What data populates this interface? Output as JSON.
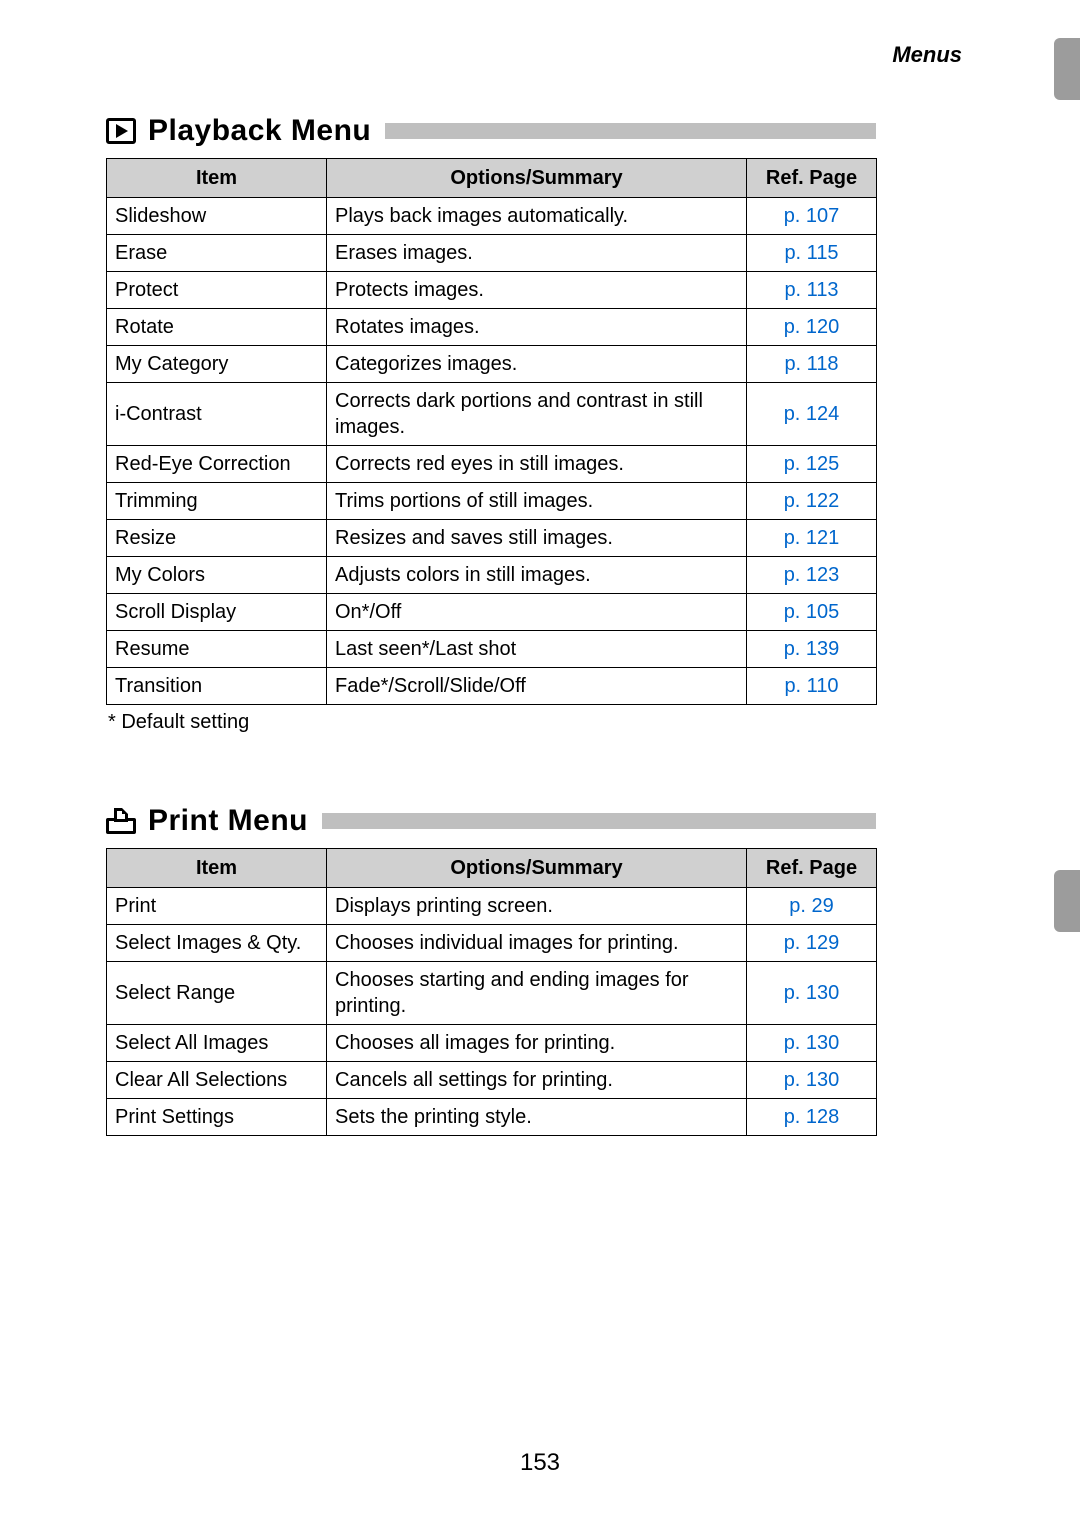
{
  "header": {
    "menus_label": "Menus"
  },
  "page_number": "153",
  "playback": {
    "title": "Playback Menu",
    "columns": {
      "item": "Item",
      "options": "Options/Summary",
      "ref": "Ref. Page"
    },
    "rows": [
      {
        "item": "Slideshow",
        "summary": "Plays back images automatically.",
        "ref": "p. 107"
      },
      {
        "item": "Erase",
        "summary": "Erases images.",
        "ref": "p. 115"
      },
      {
        "item": "Protect",
        "summary": "Protects images.",
        "ref": "p. 113"
      },
      {
        "item": "Rotate",
        "summary": "Rotates images.",
        "ref": "p. 120"
      },
      {
        "item": "My Category",
        "summary": "Categorizes images.",
        "ref": "p. 118"
      },
      {
        "item": "i-Contrast",
        "summary": "Corrects dark portions and contrast in still images.",
        "ref": "p. 124"
      },
      {
        "item": "Red-Eye Correction",
        "summary": "Corrects red eyes in still images.",
        "ref": "p. 125"
      },
      {
        "item": "Trimming",
        "summary": "Trims portions of still images.",
        "ref": "p. 122"
      },
      {
        "item": "Resize",
        "summary": "Resizes and saves still images.",
        "ref": "p. 121"
      },
      {
        "item": "My Colors",
        "summary": "Adjusts colors in still images.",
        "ref": "p. 123"
      },
      {
        "item": "Scroll Display",
        "summary": "On*/Off",
        "ref": "p. 105"
      },
      {
        "item": "Resume",
        "summary": "Last seen*/Last shot",
        "ref": "p. 139"
      },
      {
        "item": "Transition",
        "summary": "Fade*/Scroll/Slide/Off",
        "ref": "p. 110"
      }
    ],
    "footnote": "* Default setting"
  },
  "print": {
    "title": "Print Menu",
    "columns": {
      "item": "Item",
      "options": "Options/Summary",
      "ref": "Ref. Page"
    },
    "rows": [
      {
        "item": "Print",
        "summary": "Displays printing screen.",
        "ref": "p. 29"
      },
      {
        "item": "Select Images & Qty.",
        "summary": "Chooses individual images for printing.",
        "ref": "p. 129"
      },
      {
        "item": "Select Range",
        "summary": "Chooses starting and ending images for printing.",
        "ref": "p. 130"
      },
      {
        "item": "Select All Images",
        "summary": "Chooses all images for printing.",
        "ref": "p. 130"
      },
      {
        "item": "Clear All Selections",
        "summary": "Cancels all settings for printing.",
        "ref": "p. 130"
      },
      {
        "item": "Print Settings",
        "summary": "Sets the printing style.",
        "ref": "p. 128"
      }
    ]
  }
}
